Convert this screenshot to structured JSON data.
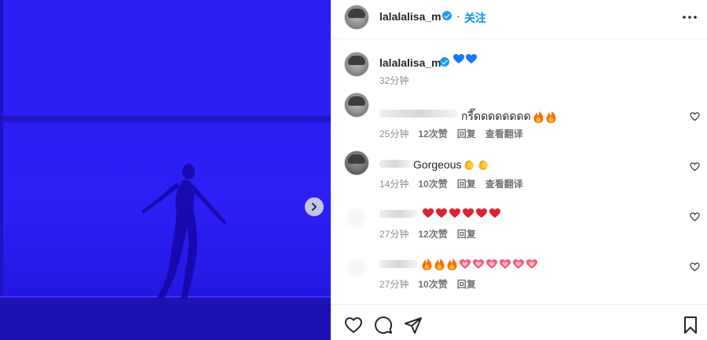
{
  "post": {
    "username": "lalalalisa_m",
    "follow_label": "关注",
    "more_icon": "more-options-icon"
  },
  "caption": {
    "username": "lalalalisa_m",
    "emoji": [
      "blue-heart",
      "blue-heart"
    ],
    "time": "32分钟"
  },
  "comments": [
    {
      "author": "",
      "text": "กรี๊ดดดดดดดด",
      "emoji": [
        "fire",
        "fire"
      ],
      "time": "25分钟",
      "likes": "12次赞",
      "reply_label": "回复",
      "translate_label": "查看翻译"
    },
    {
      "author": "",
      "text": "Gorgeous",
      "emoji": [
        "clap",
        "clap"
      ],
      "time": "14分钟",
      "likes": "10次赞",
      "reply_label": "回复",
      "translate_label": "查看翻译"
    },
    {
      "author": "",
      "text": "",
      "emoji": [
        "red-heart",
        "red-heart",
        "red-heart",
        "red-heart",
        "red-heart",
        "red-heart"
      ],
      "time": "27分钟",
      "likes": "12次赞",
      "reply_label": "回复",
      "translate_label": ""
    },
    {
      "author": "",
      "text": "",
      "emoji": [
        "fire",
        "fire",
        "fire",
        "pink-heart",
        "pink-heart",
        "pink-heart",
        "pink-heart",
        "pink-heart",
        "pink-heart"
      ],
      "time": "27分钟",
      "likes": "10次赞",
      "reply_label": "回复",
      "translate_label": ""
    }
  ],
  "colors": {
    "media_blue": "#2b1ff4",
    "follow_blue": "#0095f6",
    "verified_blue": "#1d9bf0",
    "meta_gray": "#8e8e8e"
  },
  "icons": {
    "media_next": "chevron-right-icon",
    "like": "heart-outline-icon",
    "comment": "comment-bubble-icon",
    "share": "paper-plane-icon",
    "save": "bookmark-icon"
  }
}
